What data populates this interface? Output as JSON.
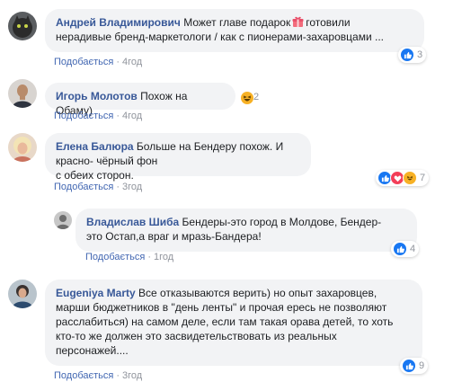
{
  "comments": [
    {
      "author": "Андрей Владимирович",
      "text_before": "Может главе подарок",
      "text_after": "готовили",
      "line2": "нерадивые бренд-маркетологи / как с пионерами-захаровцами ...",
      "icon": "gift-icon",
      "like_label": "Подобається",
      "time": "4год",
      "reaction_count": "3",
      "reactions": [
        "like"
      ]
    },
    {
      "author": "Игорь Молотов",
      "text": "Похож на Обаму)",
      "like_label": "Подобається",
      "time": "4год",
      "reaction_count": "2",
      "reactions": [
        "haha"
      ]
    },
    {
      "author": "Елена Балюра",
      "text": "Больше на Бендеру похож. И красно- чёрный фон",
      "line2": "с обеих сторон.",
      "like_label": "Подобається",
      "time": "3год",
      "reaction_count": "7",
      "reactions": [
        "like",
        "love",
        "haha"
      ]
    },
    {
      "author": "Владислав Шиба",
      "text": "Бендеры-это город в Молдове, Бендер-",
      "line2": "это Остап,а враг и мразь-Бандера!",
      "like_label": "Подобається",
      "time": "1год",
      "reaction_count": "4",
      "reactions": [
        "like"
      ]
    },
    {
      "author": "Eugeniya Marty",
      "text": "Все отказываются верить) но опыт захаровцев,",
      "line2": "марши бюджетников в \"день ленты\" и прочая ересь не позволяют",
      "line3": "расслабиться) на самом деле, если там такая орава детей, то хоть",
      "line4": "кто-то же должен это засвидетельствовать из реальных",
      "line5": "персонажей....",
      "like_label": "Подобається",
      "time": "3год",
      "reaction_count": "9",
      "reactions": [
        "like"
      ]
    }
  ],
  "colors": {
    "author": "#385898",
    "bubble": "#f2f3f5",
    "like_link": "#4267b2",
    "meta": "#90949c"
  }
}
